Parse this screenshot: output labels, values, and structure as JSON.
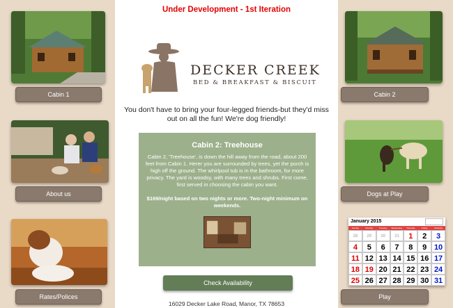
{
  "banner": "Under Development - 1st Iteration",
  "logo": {
    "title": "DECKER CREEK",
    "subtitle": "BED & BREAKFAST & BISCUIT"
  },
  "tagline": "You don't have to bring your four-legged friends-but they'd miss out on all the fun! We're dog friendly!",
  "panel": {
    "title": "Cabin 2: Treehouse",
    "description": "Cabin 2, 'Treehouse', is down the hill away from the road, about 200 feet from Cabin 1. Herer you are surrounded by trees, yet the porch is high off the ground. The whirlpool tub is in the bathroom, for more privacy. The yard is woodsy, with many trees and shrubs. First come, first served in choosing the cabin you want.",
    "price": "$169/night based on two nights or more. Two-night minimum on weekends."
  },
  "availability_button": "Check Availability",
  "address": "16029 Decker Lake Road, Manor, TX 78653",
  "left_nav": [
    {
      "label": "Cabin 1"
    },
    {
      "label": "About us"
    },
    {
      "label": "Rates/Polices"
    }
  ],
  "right_nav": [
    {
      "label": "Cabin 2"
    },
    {
      "label": "Dogs at Play"
    },
    {
      "label": "Play"
    }
  ],
  "calendar": {
    "month": "January 2015",
    "weekdays": [
      "Sunday",
      "Monday",
      "Tuesday",
      "Wednesday",
      "Thursday",
      "Friday",
      "Saturday"
    ],
    "rows": [
      [
        "28",
        "29",
        "30",
        "31",
        "1",
        "2",
        "3"
      ],
      [
        "4",
        "5",
        "6",
        "7",
        "8",
        "9",
        "10"
      ],
      [
        "11",
        "12",
        "13",
        "14",
        "15",
        "16",
        "17"
      ],
      [
        "18",
        "19",
        "20",
        "21",
        "22",
        "23",
        "24"
      ],
      [
        "25",
        "26",
        "27",
        "28",
        "29",
        "30",
        "31"
      ]
    ]
  }
}
